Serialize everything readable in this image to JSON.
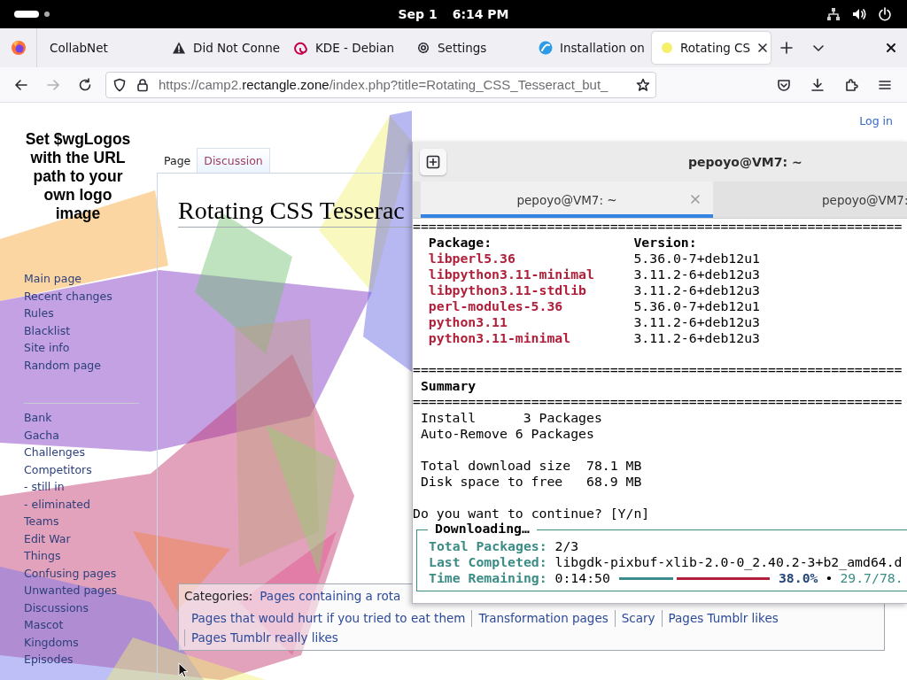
{
  "system_bar": {
    "date": "Sep 1",
    "time": "6:14 PM"
  },
  "browser_tabs": [
    {
      "label": "CollabNet",
      "kind": "plain",
      "selected": false
    },
    {
      "label": "Did Not Conne",
      "kind": "warning",
      "selected": false
    },
    {
      "label": "KDE - Debian",
      "kind": "swirl",
      "selected": false
    },
    {
      "label": "Settings",
      "kind": "gear",
      "selected": false
    },
    {
      "label": "Installation on",
      "kind": "circle",
      "selected": false
    },
    {
      "label": "Rotating CS",
      "kind": "dot",
      "selected": true
    }
  ],
  "navigation": {
    "back_disabled": false,
    "forward_disabled": true
  },
  "address_bar": {
    "prefix": "https://camp2.",
    "domain": "rectangle.zone",
    "path": "/index.php?title=Rotating_CSS_Tesseract_but_"
  },
  "wiki": {
    "logo_text": "Set $wgLogos with the URL path to your own logo image",
    "nav_links": [
      "Main page",
      "Recent changes",
      "Rules",
      "Blacklist",
      "Site info",
      "Random page"
    ],
    "section_links": [
      "Bank",
      "Gacha",
      "Challenges",
      "Competitors",
      "- still in",
      "- eliminated",
      "Teams",
      "Edit War",
      "Things",
      "Confusing pages",
      "Unwanted pages",
      "Discussions",
      "Mascot",
      "Kingdoms",
      "Episodes"
    ],
    "login": "Log in",
    "page_tabs": [
      {
        "label": "Page",
        "selected": true
      },
      {
        "label": "Discussion",
        "selected": false
      }
    ],
    "title": "Rotating CSS Tesserac",
    "categories": {
      "label": "Categories:",
      "links": [
        "Pages containing a rota",
        "Pages that would hurt if you tried to eat them",
        "Transformation pages",
        "Scary",
        "Pages Tumblr likes",
        "Pages Tumblr really likes"
      ]
    }
  },
  "terminal": {
    "title": "pepoyo@VM7: ~",
    "tabs": [
      {
        "label": "pepoyo@VM7: ~",
        "selected": true
      },
      {
        "label": "pepoyo@VM7:",
        "selected": false
      }
    ],
    "lines": [
      {
        "kind": "rule",
        "text": "=============================================================="
      },
      {
        "kind": "header",
        "package": "Package:",
        "version": "Version:"
      },
      {
        "kind": "package",
        "package": "libperl5.36",
        "version": "5.36.0-7+deb12u1"
      },
      {
        "kind": "package",
        "package": "libpython3.11-minimal",
        "version": "3.11.2-6+deb12u3"
      },
      {
        "kind": "package",
        "package": "libpython3.11-stdlib",
        "version": "3.11.2-6+deb12u3"
      },
      {
        "kind": "package",
        "package": "perl-modules-5.36",
        "version": "5.36.0-7+deb12u1"
      },
      {
        "kind": "package",
        "package": "python3.11",
        "version": "3.11.2-6+deb12u3"
      },
      {
        "kind": "package",
        "package": "python3.11-minimal",
        "version": "3.11.2-6+deb12u3"
      },
      {
        "kind": "blank"
      },
      {
        "kind": "rule",
        "text": "=============================================================="
      },
      {
        "kind": "heading",
        "text": "Summary"
      },
      {
        "kind": "rule",
        "text": "=============================================================="
      },
      {
        "kind": "text",
        "text": "Install      3 Packages"
      },
      {
        "kind": "text",
        "text": "Auto-Remove 6 Packages"
      },
      {
        "kind": "blank"
      },
      {
        "kind": "text",
        "text": "Total download size  78.1 MB"
      },
      {
        "kind": "text",
        "text": "Disk space to free   68.9 MB"
      },
      {
        "kind": "blank"
      },
      {
        "kind": "prompt",
        "text": "Do you want to continue? [Y/n]"
      }
    ],
    "download": {
      "title": "Downloading…",
      "rows": [
        {
          "label": "Total Packages:",
          "value": "2/3"
        },
        {
          "label": "Last Completed:",
          "value": "libgdk-pixbuf-xlib-2.0-0_2.40.2-3+b2_amd64.d"
        }
      ],
      "time_label": "Time Remaining:",
      "time": "0:14:50",
      "level": 0.38,
      "percent": "38.0%",
      "separator": "•",
      "size": "29.7/78."
    }
  }
}
